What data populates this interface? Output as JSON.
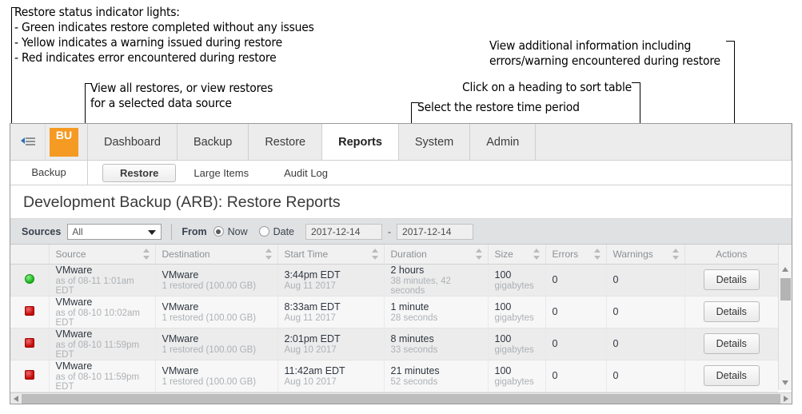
{
  "annotations": [
    {
      "id": "status-lights",
      "lines": [
        "Restore status indicator lights:",
        " - Green indicates restore completed without any issues",
        " - Yellow indicates a warning issued during restore",
        " - Red indicates error encountered during restore"
      ]
    },
    {
      "id": "sources",
      "lines": [
        "View all restores, or view restores",
        "for a selected data source"
      ]
    },
    {
      "id": "details",
      "lines": [
        "View additional information including",
        "errors/warning encountered during restore"
      ]
    },
    {
      "id": "sort",
      "lines": [
        "Click on a heading to sort table"
      ]
    },
    {
      "id": "time-period",
      "lines": [
        "Select the restore time period"
      ]
    }
  ],
  "nav": {
    "collapse_icon": "collapse-sidebar-icon",
    "logo_text": "BU",
    "tabs": [
      {
        "label": "Dashboard",
        "active": false
      },
      {
        "label": "Backup",
        "active": false
      },
      {
        "label": "Restore",
        "active": false
      },
      {
        "label": "Reports",
        "active": true
      },
      {
        "label": "System",
        "active": false
      },
      {
        "label": "Admin",
        "active": false
      }
    ]
  },
  "subnav": {
    "left_label": "Backup",
    "tabs": [
      {
        "label": "Restore",
        "active": true
      },
      {
        "label": "Large Items",
        "active": false
      },
      {
        "label": "Audit Log",
        "active": false
      }
    ]
  },
  "page": {
    "title": "Development Backup (ARB): Restore Reports"
  },
  "filters": {
    "sources_label": "Sources",
    "sources_value": "All",
    "from_label": "From",
    "now_label": "Now",
    "date_label": "Date",
    "date_start": "2017-12-14",
    "date_separator": "-",
    "date_end": "2017-12-14"
  },
  "table": {
    "columns": [
      {
        "key": "status",
        "label": "",
        "sortable": false
      },
      {
        "key": "source",
        "label": "Source",
        "sortable": true
      },
      {
        "key": "destination",
        "label": "Destination",
        "sortable": true
      },
      {
        "key": "start_time",
        "label": "Start Time",
        "sortable": true
      },
      {
        "key": "duration",
        "label": "Duration",
        "sortable": true
      },
      {
        "key": "size",
        "label": "Size",
        "sortable": true
      },
      {
        "key": "errors",
        "label": "Errors",
        "sortable": true
      },
      {
        "key": "warnings",
        "label": "Warnings",
        "sortable": true
      },
      {
        "key": "actions",
        "label": "Actions",
        "sortable": false
      }
    ],
    "action_label": "Details",
    "rows": [
      {
        "status": "green",
        "source": "VMware",
        "source_sub": "as of 08-11 1:01am EDT",
        "destination": "VMware",
        "destination_sub": "1 restored (100.00 GB)",
        "start_time": "3:44pm EDT",
        "start_time_sub": "Aug 11 2017",
        "duration": "2 hours",
        "duration_sub": "38 minutes, 42 seconds",
        "size": "100",
        "size_sub": "gigabytes",
        "errors": "0",
        "warnings": "0"
      },
      {
        "status": "red",
        "source": "VMware",
        "source_sub": "as of 08-10 10:02am EDT",
        "destination": "VMware",
        "destination_sub": "1 restored (100.00 GB)",
        "start_time": "8:33am EDT",
        "start_time_sub": "Aug 11 2017",
        "duration": "1 minute",
        "duration_sub": "28 seconds",
        "size": "100",
        "size_sub": "gigabytes",
        "errors": "0",
        "warnings": "0"
      },
      {
        "status": "red",
        "source": "VMware",
        "source_sub": "as of 08-10 11:59pm EDT",
        "destination": "VMware",
        "destination_sub": "1 restored (100.00 GB)",
        "start_time": "2:01pm EDT",
        "start_time_sub": "Aug 10 2017",
        "duration": "8 minutes",
        "duration_sub": "33 seconds",
        "size": "100",
        "size_sub": "gigabytes",
        "errors": "0",
        "warnings": "0"
      },
      {
        "status": "red",
        "source": "VMware",
        "source_sub": "as of 08-10 11:59pm EDT",
        "destination": "VMware",
        "destination_sub": "1 restored (100.00 GB)",
        "start_time": "11:42am EDT",
        "start_time_sub": "Aug 10 2017",
        "duration": "21 minutes",
        "duration_sub": "52 seconds",
        "size": "100",
        "size_sub": "gigabytes",
        "errors": "0",
        "warnings": "0"
      }
    ]
  },
  "colors": {
    "brand_orange": "#f59a23",
    "status_green": "#19b219",
    "status_red": "#c10b0b",
    "status_yellow": "#e8b800"
  }
}
